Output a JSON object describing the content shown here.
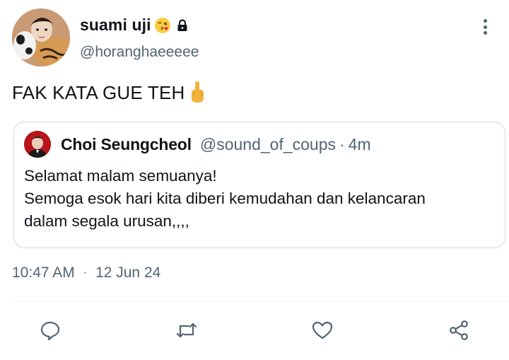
{
  "author": {
    "display_name": "suami uji",
    "handle": "@horanghaeeeee",
    "name_emoji": "kissing-face-icon",
    "protected_icon": "lock-icon"
  },
  "tweet": {
    "text": "FAK KATA GUE TEH",
    "text_emoji": "middle-finger-icon",
    "time": "10:47 AM",
    "separator": "·",
    "date": "12 Jun 24"
  },
  "quoted_tweet": {
    "display_name": "Choi Seungcheol",
    "handle": "@sound_of_coups",
    "separator": "·",
    "time_ago": "4m",
    "lines": [
      "Selamat malam semuanya!",
      "Semoga esok hari kita diberi kemudahan dan kelancaran",
      "dalam segala urusan,,,,"
    ]
  },
  "actions": {
    "reply_icon": "reply-icon",
    "retweet_icon": "retweet-icon",
    "like_icon": "heart-icon",
    "share_icon": "share-icon"
  },
  "colors": {
    "text": "#0f1419",
    "secondary": "#536471",
    "border": "#cfd9de",
    "divider": "#eff3f4"
  }
}
